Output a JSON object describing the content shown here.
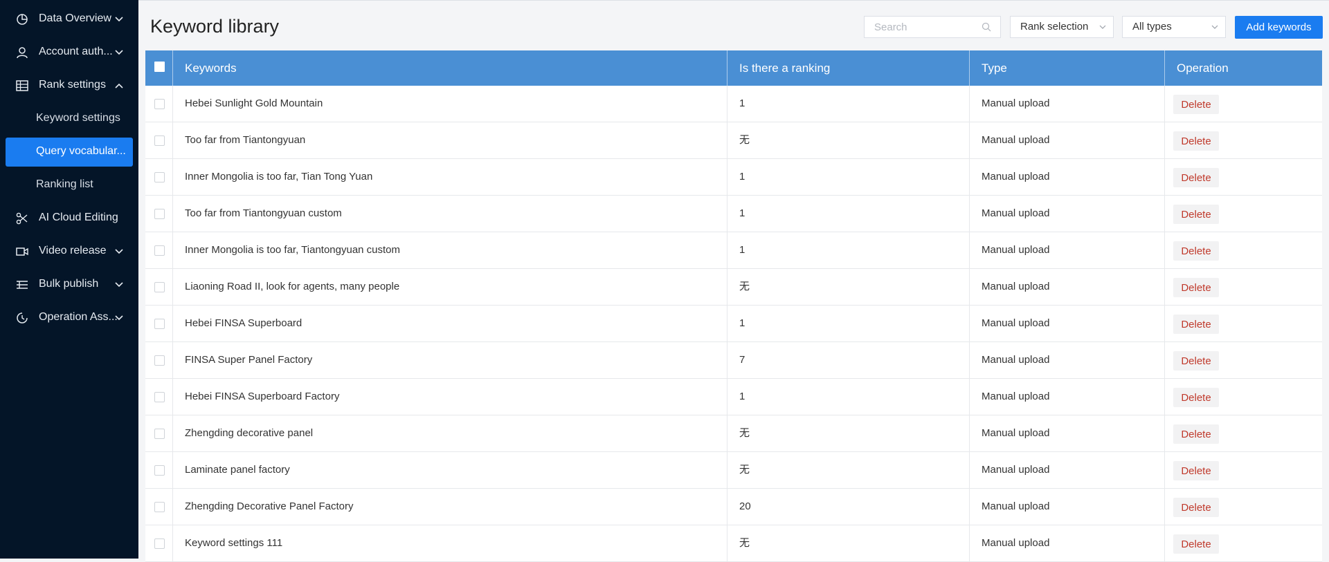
{
  "sidebar": {
    "items": [
      {
        "label": "Data Overview",
        "icon": "pie-chart-icon",
        "chevron": "down"
      },
      {
        "label": "Account auth...",
        "icon": "user-icon",
        "chevron": "down"
      },
      {
        "label": "Rank settings",
        "icon": "table-grid-icon",
        "chevron": "up"
      },
      {
        "label": "AI Cloud Editing",
        "icon": "scissors-icon"
      },
      {
        "label": "Video release",
        "icon": "video-camera-icon",
        "chevron": "down"
      },
      {
        "label": "Bulk publish",
        "icon": "list-icon",
        "chevron": "down"
      },
      {
        "label": "Operation Ass...",
        "icon": "clock-chart-icon",
        "chevron": "down"
      }
    ],
    "sub_items": [
      {
        "label": "Keyword settings",
        "active": false
      },
      {
        "label": "Query vocabular...",
        "active": true
      },
      {
        "label": "Ranking list",
        "active": false
      }
    ]
  },
  "header": {
    "title": "Keyword library",
    "search_placeholder": "Search",
    "rank_select": "Rank selection",
    "type_select": "All types",
    "add_button": "Add keywords"
  },
  "table": {
    "columns": [
      "Keywords",
      "Is there a ranking",
      "Type",
      "Operation"
    ],
    "delete_label": "Delete",
    "rows": [
      {
        "keyword": "Hebei Sunlight Gold Mountain",
        "ranking": "1",
        "type": "Manual upload"
      },
      {
        "keyword": "Too far from Tiantongyuan",
        "ranking": "无",
        "type": "Manual upload"
      },
      {
        "keyword": "Inner Mongolia is too far, Tian Tong Yuan",
        "ranking": "1",
        "type": "Manual upload"
      },
      {
        "keyword": "Too far from Tiantongyuan custom",
        "ranking": "1",
        "type": "Manual upload"
      },
      {
        "keyword": "Inner Mongolia is too far, Tiantongyuan custom",
        "ranking": "1",
        "type": "Manual upload"
      },
      {
        "keyword": "Liaoning Road II, look for agents, many people",
        "ranking": "无",
        "type": "Manual upload"
      },
      {
        "keyword": "Hebei FINSA Superboard",
        "ranking": "1",
        "type": "Manual upload"
      },
      {
        "keyword": "FINSA Super Panel Factory",
        "ranking": "7",
        "type": "Manual upload"
      },
      {
        "keyword": "Hebei FINSA Superboard Factory",
        "ranking": "1",
        "type": "Manual upload"
      },
      {
        "keyword": "Zhengding decorative panel",
        "ranking": "无",
        "type": "Manual upload"
      },
      {
        "keyword": "Laminate panel factory",
        "ranking": "无",
        "type": "Manual upload"
      },
      {
        "keyword": "Zhengding Decorative Panel Factory",
        "ranking": "20",
        "type": "Manual upload"
      },
      {
        "keyword": "Keyword settings 111",
        "ranking": "无",
        "type": "Manual upload"
      }
    ]
  },
  "colors": {
    "sidebar_bg": "#041528",
    "accent": "#1a7cf0",
    "table_header": "#4a8fd4",
    "delete_text": "#c0392b"
  }
}
